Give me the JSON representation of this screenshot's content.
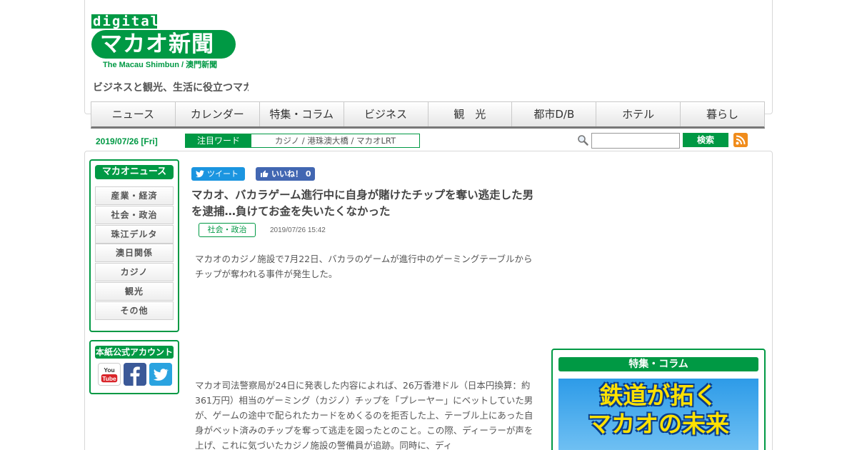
{
  "header": {
    "logo_digital": "digital",
    "logo_main": "マカオ新聞",
    "logo_sub": "The Macau Shimbun / 澳門新聞",
    "tagline": "ビジネスと観光、生活に役立つマカ"
  },
  "nav": {
    "items": [
      "ニュース",
      "カレンダー",
      "特集・コラム",
      "ビジネス",
      "観　光",
      "都市D/B",
      "ホテル",
      "暮らし"
    ]
  },
  "subbar": {
    "date": "2019/07/26 [Fri]",
    "keywords_label": "注目ワード",
    "keywords": "カジノ / 港珠澳大橋 / マカオLRT",
    "search_placeholder": "",
    "search_button": "検索"
  },
  "sidebar": {
    "news_title": "マカオニュース",
    "categories": [
      "産業・経済",
      "社会・政治",
      "珠江デルタ",
      "澳日関係",
      "カジノ",
      "観光",
      "その他"
    ],
    "account_title": "本紙公式アカウント",
    "youtube_label": "You Tube"
  },
  "article": {
    "tweet_label": "ツイート",
    "like_label": "いいね！ 0",
    "title": "マカオ、バカラゲーム進行中に自身が賭けたチップを奪い逃走した男を逮捕…負けてお金を失いたくなかった",
    "category": "社会・政治",
    "timestamp": "2019/07/26 15:42",
    "lead": "マカオのカジノ施設で7月22日、バカラのゲームが進行中のゲーミングテーブルからチップが奪われる事件が発生した。",
    "body": "マカオ司法警察局が24日に発表した内容によれば、26万香港ドル（日本円換算：約361万円）相当のゲーミング（カジノ）チップを「プレーヤー」にベットしていた男が、ゲームの途中で配られたカードをめくるのを拒否した上、テーブル上にあった自身がベット済みのチップを奪って逃走を図ったとのこと。この際、ディーラーが声を上げ、これに気づいたカジノ施設の警備員が追跡。同時に、ディ"
  },
  "feature": {
    "title": "特集・コラム",
    "banner_line1": "鉄道が拓く",
    "banner_line2": "マカオの未来"
  },
  "colors": {
    "brand_green": "#009944",
    "facebook_blue": "#3b5998",
    "twitter_blue": "#1b95e0",
    "rss_orange": "#f08c1c"
  }
}
